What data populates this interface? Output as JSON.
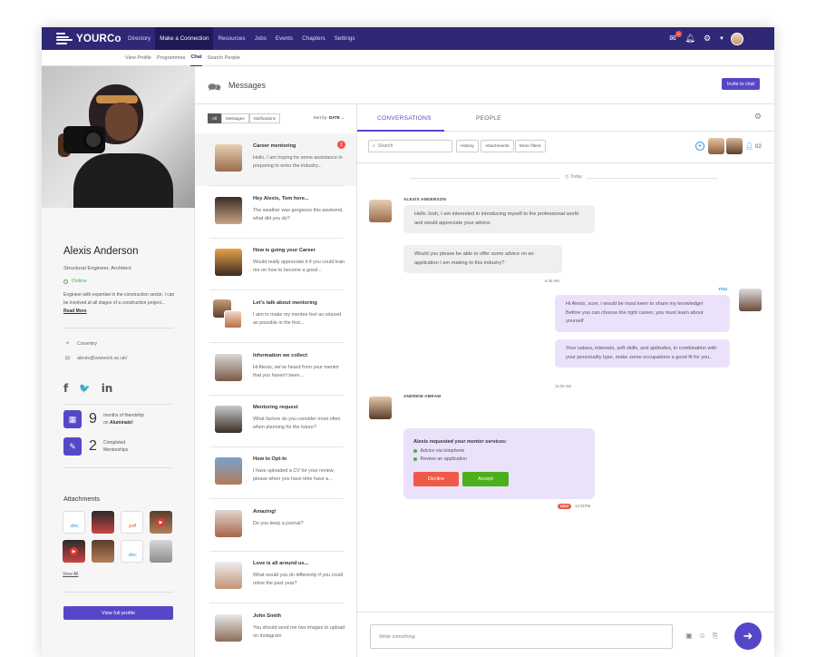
{
  "brand": {
    "name": "YOURCo"
  },
  "nav": {
    "items": [
      "Directory",
      "Make a Connection",
      "Resources",
      "Jobs",
      "Events",
      "Chapters",
      "Settings"
    ],
    "active_index": 1,
    "mail_badge": "2"
  },
  "subnav": {
    "items": [
      "View Profile",
      "Programmes",
      "Chat",
      "Search People"
    ],
    "active_index": 2
  },
  "profile": {
    "name": "Alexis Anderson",
    "title": "Structural Engineer, Architect",
    "status": "Online",
    "bio": "Engineer with expertise in the construction sector, I can be involved at all stages of a construction project...",
    "read_more": "Read More",
    "location": "Coventry",
    "email": "alexis@warwick.ac.uk/",
    "socials": [
      "f",
      "🐦",
      "in"
    ],
    "stats": [
      {
        "number": "9",
        "label_line1": "months of friendship",
        "label_line2": "on",
        "label_bold": "Aluminate!"
      },
      {
        "number": "2",
        "label_line1": "Completed",
        "label_line2": "Mentorships",
        "label_bold": ""
      }
    ],
    "attachments_title": "Attachments",
    "attachments": [
      ".doc",
      "",
      ".pdf",
      "",
      "",
      "",
      "",
      ".doc",
      ""
    ],
    "view_all": "View All",
    "full_profile": "View full profile"
  },
  "messages": {
    "title": "Messages",
    "invite": "Invite to chat",
    "filters": [
      "All",
      "Messages",
      "Notifications"
    ],
    "sort_label": "Sort by:",
    "sort_value": "DATE"
  },
  "conversations": [
    {
      "name": "Career mentoring",
      "text": "Hello, I am hoping for some assistance in preparing to enter the industry...",
      "badge": "1"
    },
    {
      "name": "Hey Alexis, Tom here...",
      "text": "The weather was gorgeous this weekend, what did you do?",
      "badge": ""
    },
    {
      "name": "How is going your Career",
      "text": "Would really appreciate it if you could train me on how to become a good...",
      "badge": ""
    },
    {
      "name": "Let's talk about mentoring",
      "text": "I aim to make my mentee feel as relaxed as possible in the first...",
      "badge": ""
    },
    {
      "name": "Information we collect",
      "text": "Hi Alexis, we've heard from your mentor that you haven't been...",
      "badge": ""
    },
    {
      "name": "Mentoring request",
      "text": "What factors do you consider most often when planning for the future?",
      "badge": ""
    },
    {
      "name": "How to Opt-In",
      "text": "I have uploaded a CV for your review, please when you have time have a...",
      "badge": ""
    },
    {
      "name": "Amazing!",
      "text": "Do you keep a journal?",
      "badge": ""
    },
    {
      "name": "Love is all around us...",
      "text": "What would you do differently if you could relive the past year?",
      "badge": ""
    },
    {
      "name": "John Smith",
      "text": "You should send me two images to upload on Instagram",
      "badge": ""
    }
  ],
  "chat": {
    "tabs": [
      "CONVERSATIONS",
      "PEOPLE"
    ],
    "search_placeholder": "Search",
    "tools": [
      "History",
      "Attachments",
      "More filters"
    ],
    "people_count": "02",
    "day": "Today",
    "sender1": "ALEXIS ANDERSON",
    "msg1": "Hello Josh, I am interested in introducing myself to the professional world and would appreciate your advice.",
    "msg2": "Would you please be able to offer some advice on an application I am making to this industry?",
    "time1": "6:45 AM",
    "you_label": "YOU",
    "msg3": "Hi Alexis, sure, i would be most keen to share my knowledge! Before you can choose the right career, you must learn about yourself",
    "msg4": "Your values, interests, soft skills, and aptitudes, in combination with your personality type, make some occupations a good fit for you..",
    "time2": "11:03 AM",
    "sender2": "ANDREW ABRAM",
    "request_title": "Alexis requested your mentor services:",
    "request_items": [
      "Advice via telephone",
      "Review an application"
    ],
    "decline": "Decline",
    "accept": "Accept",
    "new_label": "NEW",
    "time3": "12:01PM",
    "compose_placeholder": "Write something"
  },
  "colors": {
    "nav_bg": "#2e2876",
    "accent": "#5647c9",
    "online": "#4caf50",
    "decline": "#ef5a48",
    "accept": "#4caf1c",
    "badge": "#f0574a"
  }
}
